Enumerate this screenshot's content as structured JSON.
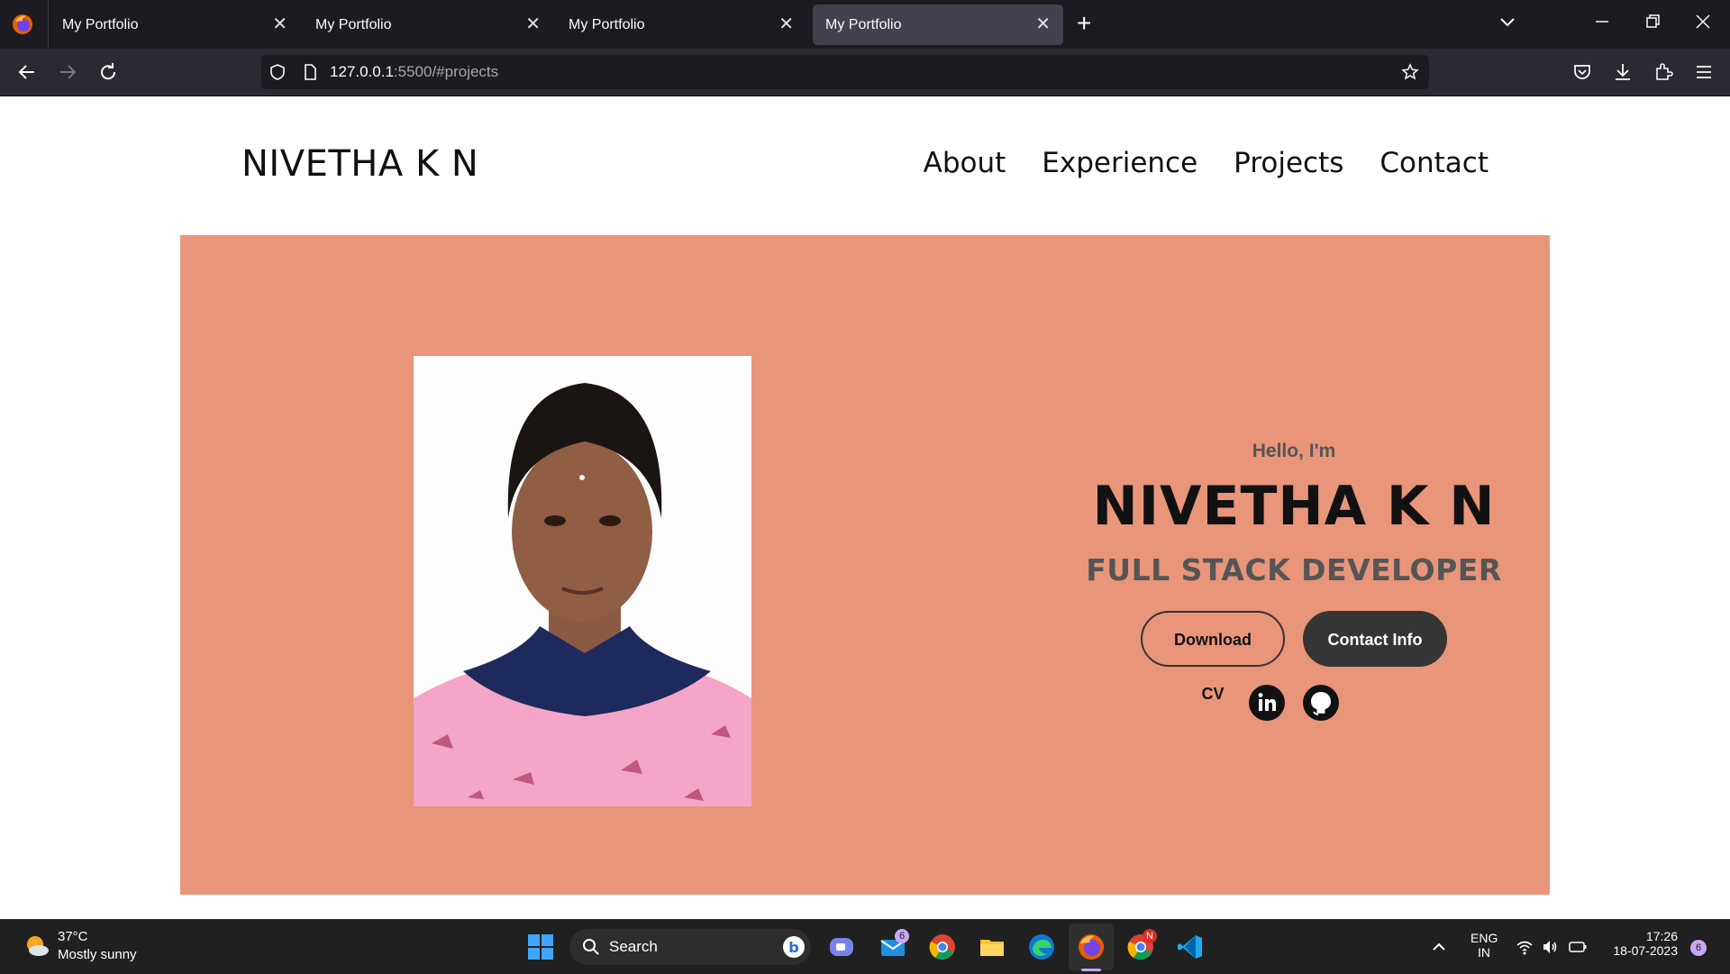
{
  "browser": {
    "tabs": [
      {
        "title": "My Portfolio",
        "active": false
      },
      {
        "title": "My Portfolio",
        "active": false
      },
      {
        "title": "My Portfolio",
        "active": false
      },
      {
        "title": "My Portfolio",
        "active": true
      }
    ],
    "url_host": "127.0.0.1",
    "url_rest": ":5500/#projects"
  },
  "site": {
    "logo": "NIVETHA K N",
    "nav": [
      "About",
      "Experience",
      "Projects",
      "Contact"
    ]
  },
  "hero": {
    "greeting": "Hello, I'm",
    "name": "NIVETHA K N",
    "role": "FULL STACK DEVELOPER",
    "download_label": "Download CV",
    "contact_label": "Contact Info",
    "bg_color": "#e9957a"
  },
  "taskbar": {
    "temperature": "37°C",
    "condition": "Mostly sunny",
    "search_label": "Search",
    "mail_badge": "6",
    "chrome_badge": "N",
    "lang_top": "ENG",
    "lang_bottom": "IN",
    "time": "17:26",
    "date": "18-07-2023",
    "notif_count": "6"
  }
}
